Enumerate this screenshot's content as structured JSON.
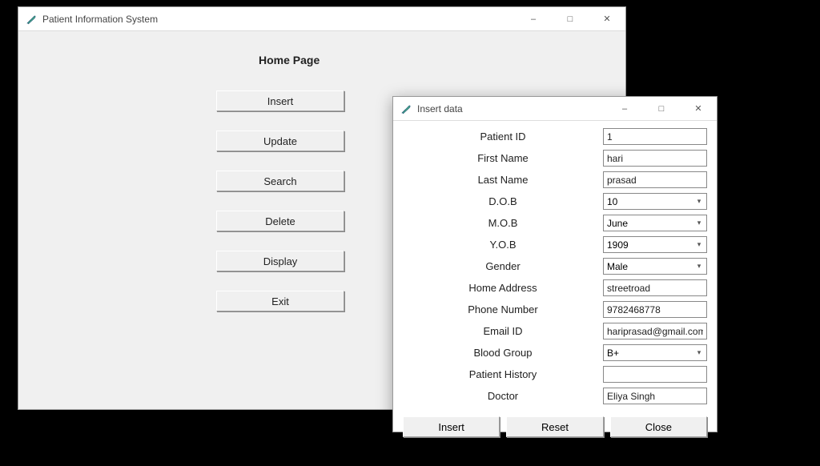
{
  "main": {
    "title": "Patient Information System",
    "heading": "Home Page",
    "buttons": {
      "insert": "Insert",
      "update": "Update",
      "search": "Search",
      "delete": "Delete",
      "display": "Display",
      "exit": "Exit"
    }
  },
  "dialog": {
    "title": "Insert data",
    "labels": {
      "patient_id": "Patient ID",
      "first_name": "First Name",
      "last_name": "Last Name",
      "dob": "D.O.B",
      "mob": "M.O.B",
      "yob": "Y.O.B",
      "gender": "Gender",
      "address": "Home Address",
      "phone": "Phone Number",
      "email": "Email ID",
      "blood": "Blood Group",
      "history": "Patient History",
      "doctor": "Doctor"
    },
    "values": {
      "patient_id": "1",
      "first_name": "hari",
      "last_name": "prasad",
      "dob": "10",
      "mob": "June",
      "yob": "1909",
      "gender": "Male",
      "address": "streetroad",
      "phone": "9782468778",
      "email": "hariprasad@gmail.com",
      "blood": "B+",
      "history": "",
      "doctor": "Eliya Singh"
    },
    "buttons": {
      "insert": "Insert",
      "reset": "Reset",
      "close": "Close"
    }
  }
}
